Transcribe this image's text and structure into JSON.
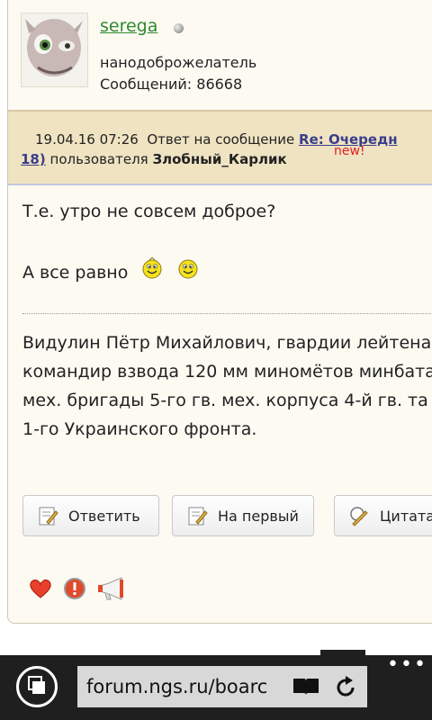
{
  "post": {
    "author": {
      "username": "serega",
      "rank": "нанодоброжелатель",
      "posts_label": "Сообщений: 86668"
    },
    "reply_header": {
      "datetime": "19.04.16 07:26",
      "reply_to_text": "Ответ на сообщение",
      "reply_link": "Re: Очередн",
      "reply_link_cont": "18)",
      "by_user_text": "пользователя",
      "reply_user": "Злобный_Карлик",
      "new_badge": "new!"
    },
    "message": {
      "line1": "Т.е. утро не совсем доброе?",
      "line2": "А все равно",
      "paragraph": [
        "Видулин Пётр Михайлович, гвардии лейтена",
        "командир взвода 120 мм миномётов минбата",
        "мех. бригады 5-го гв. мех. корпуса 4-й гв. та",
        "1-го Украинского фронта."
      ]
    },
    "buttons": {
      "reply": "Ответить",
      "to_first": "На первый",
      "quote": "Цитата"
    }
  },
  "browser": {
    "url": "forum.ngs.ru/boarc",
    "more": "•••"
  },
  "icons": {
    "avatar": "alien-avatar",
    "online_status": "gray-dot-icon",
    "smileys": [
      "smiley-icon",
      "smiley-icon"
    ],
    "actions": [
      "heart-icon",
      "warning-icon",
      "megaphone-icon"
    ]
  },
  "colors": {
    "username": "#2f8a2f",
    "reply_header_bg": "#efe3c2",
    "link": "#3a3e8a",
    "new_badge": "#e02020",
    "browser_bar": "#1f1f1f"
  }
}
